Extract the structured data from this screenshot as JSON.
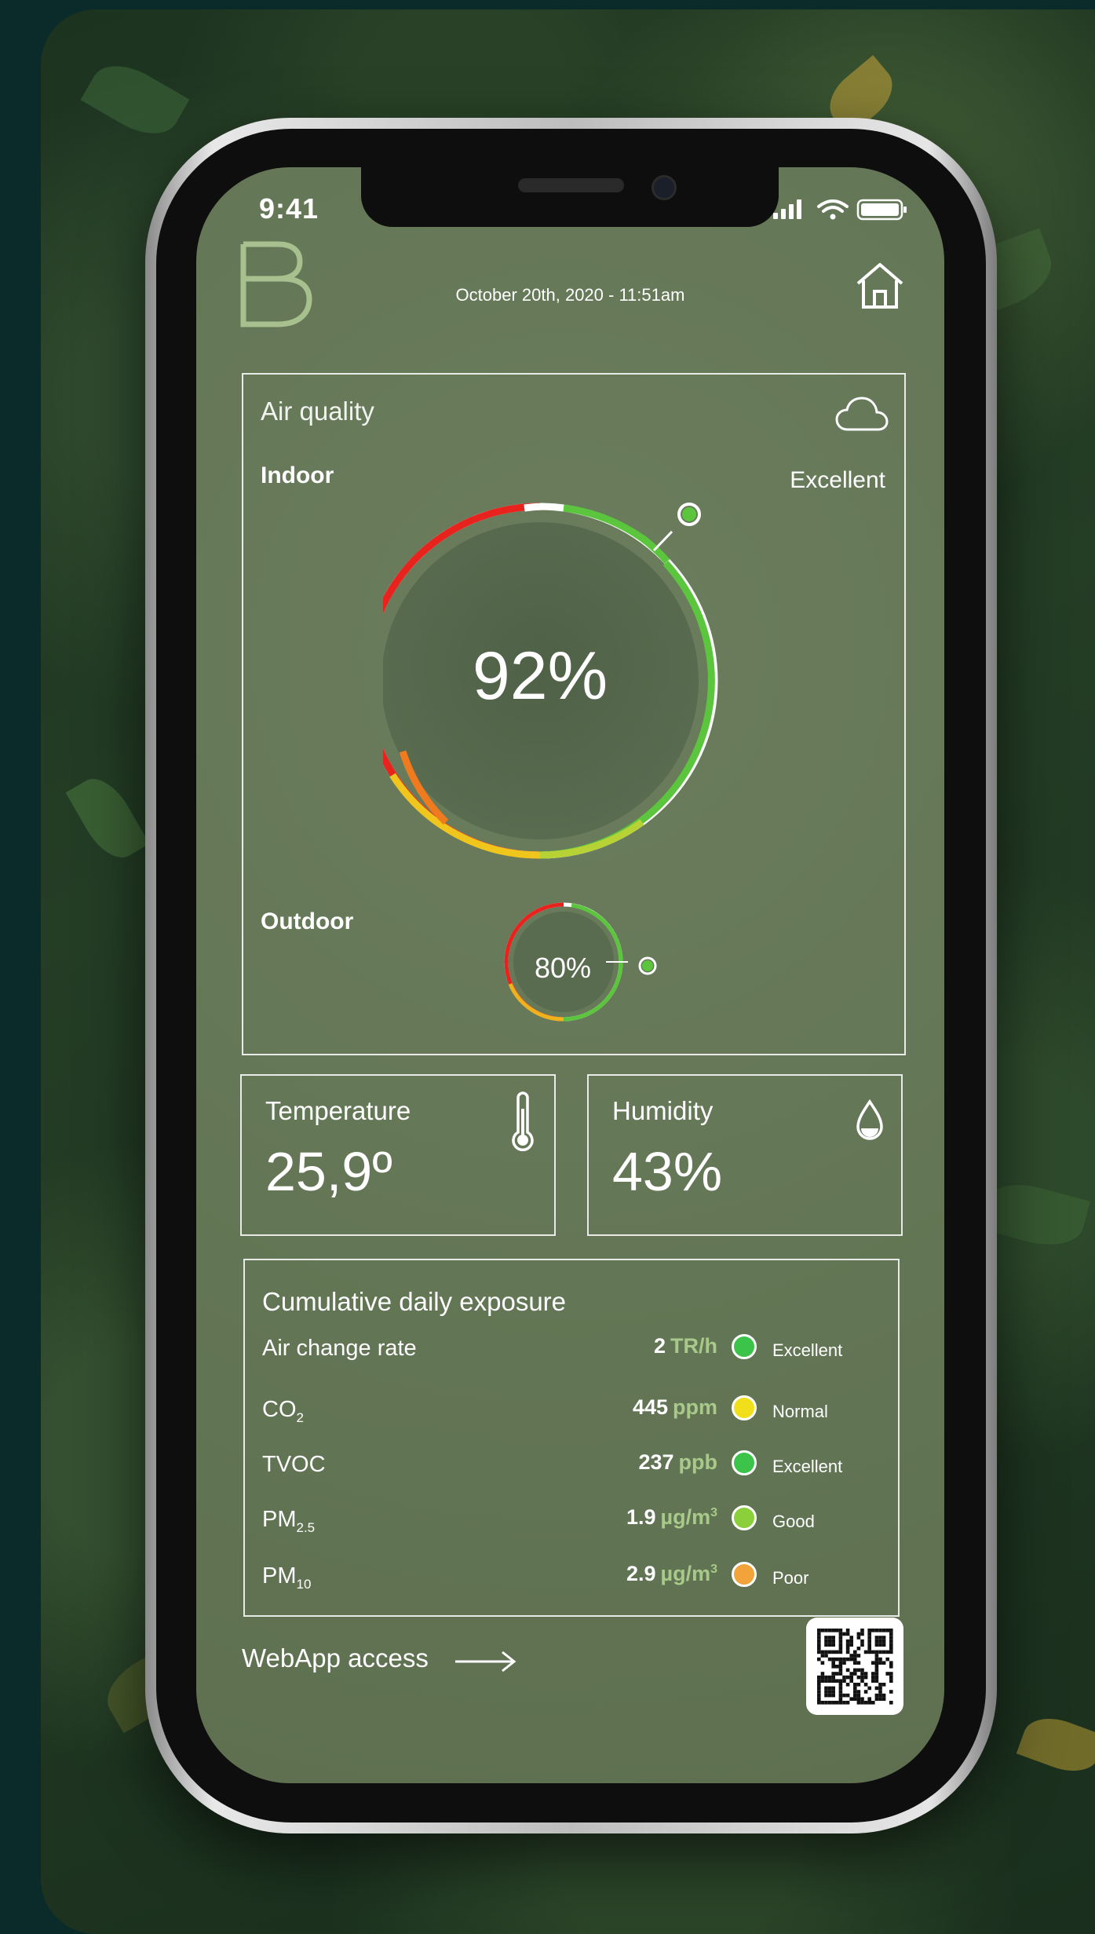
{
  "status_bar": {
    "time": "9:41"
  },
  "header": {
    "logo_letter": "B",
    "datetime": "October 20th, 2020 - 11:51am"
  },
  "air_quality": {
    "title": "Air quality",
    "indoor_label": "Indoor",
    "indoor_rating": "Excellent",
    "indoor_value": "92%",
    "indoor_percent": 92,
    "outdoor_label": "Outdoor",
    "outdoor_value": "80%",
    "outdoor_percent": 80
  },
  "temperature": {
    "title": "Temperature",
    "value": "25,9º"
  },
  "humidity": {
    "title": "Humidity",
    "value": "43%"
  },
  "exposure": {
    "title": "Cumulative daily exposure",
    "rows": [
      {
        "name": "Air change rate",
        "sub": "",
        "value": "2",
        "unit": "TR/h",
        "unit_sup": "",
        "status": "Excellent",
        "color": "#3cc34a"
      },
      {
        "name": "CO",
        "sub": "2",
        "value": "445",
        "unit": "ppm",
        "unit_sup": "",
        "status": "Normal",
        "color": "#f2df1c"
      },
      {
        "name": "TVOC",
        "sub": "",
        "value": "237",
        "unit": "ppb",
        "unit_sup": "",
        "status": "Excellent",
        "color": "#3cc34a"
      },
      {
        "name": "PM",
        "sub": "2.5",
        "value": "1.9",
        "unit": "µg/m",
        "unit_sup": "3",
        "status": "Good",
        "color": "#8bcf3a"
      },
      {
        "name": "PM",
        "sub": "10",
        "value": "2.9",
        "unit": "µg/m",
        "unit_sup": "3",
        "status": "Poor",
        "color": "#f2a33a"
      }
    ]
  },
  "footer": {
    "webapp_label": "WebApp access"
  },
  "colors": {
    "screen_bg": "#627554",
    "accent_green": "#a9c98b",
    "gauge_red": "#e8231e",
    "gauge_green": "#5cc53e"
  }
}
